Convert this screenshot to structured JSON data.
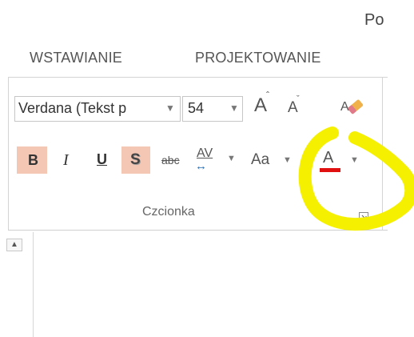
{
  "window": {
    "title_fragment": "Po"
  },
  "ribbon": {
    "tabs": [
      {
        "label": "WSTAWIANIE"
      },
      {
        "label": "PROJEKTOWANIE"
      }
    ]
  },
  "font_group": {
    "font_name": "Verdana (Tekst p",
    "font_size": "54",
    "grow_label": "A",
    "shrink_label": "A",
    "bold_label": "B",
    "italic_label": "I",
    "underline_label": "U",
    "shadow_label": "S",
    "strikethrough_label": "abc",
    "spacing_label": "AV",
    "change_case_label": "Aa",
    "font_color_label": "A",
    "group_label": "Czcionka",
    "font_color": "#e01010",
    "highlight_color": "#f4c6b4"
  },
  "annotation": {
    "color": "#f5f000"
  },
  "icons": {
    "dropdown": "chevron-down-icon",
    "grow_font": "grow-font-icon",
    "shrink_font": "shrink-font-icon",
    "clear_formatting": "eraser-icon",
    "dialog_launcher": "dialog-launcher-icon",
    "scroll_up": "scroll-up-arrow-icon"
  }
}
